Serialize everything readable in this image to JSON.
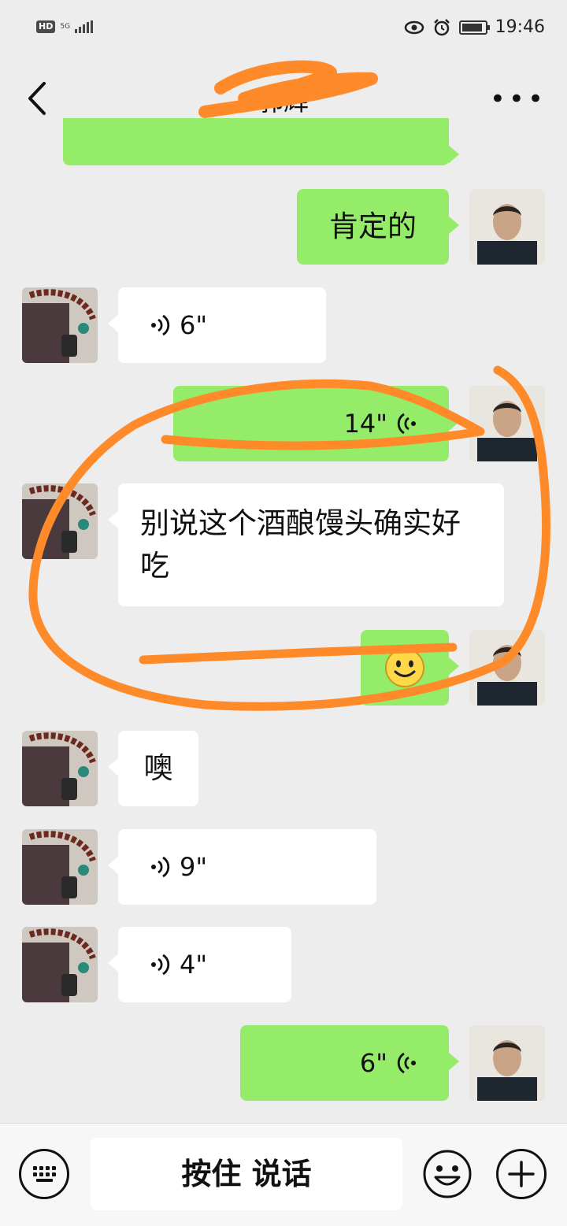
{
  "status": {
    "net": "5G",
    "time": "19:46"
  },
  "nav": {
    "title": "郭辉"
  },
  "messages": {
    "m1": "肯定的",
    "m2": "6\"",
    "m3": "14\"",
    "m4": "别说这个酒酿馒头确实好吃",
    "m6": "噢",
    "m7": "9\"",
    "m8": "4\"",
    "m9": "6\""
  },
  "input": {
    "hold_label": "按住 说话"
  },
  "colors": {
    "sent": "#95ec69",
    "received": "#ffffff",
    "background": "#ededed",
    "annotation": "#ff8a2a"
  }
}
